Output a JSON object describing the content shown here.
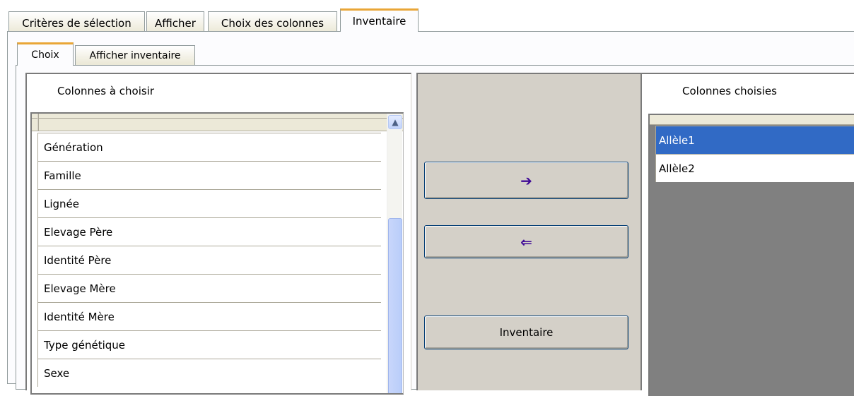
{
  "top_tabs": [
    {
      "label": "Critères de sélection"
    },
    {
      "label": "Afficher"
    },
    {
      "label": "Choix des colonnes"
    },
    {
      "label": "Inventaire"
    }
  ],
  "sub_tabs": [
    {
      "label": "Choix"
    },
    {
      "label": "Afficher inventaire"
    }
  ],
  "left_group": {
    "title": "Colonnes à choisir",
    "items": [
      "Génération",
      "Famille",
      "Lignée",
      "Elevage Père",
      "Identité Père",
      "Elevage Mère",
      "Identité Mère",
      "Type génétique",
      "Sexe"
    ]
  },
  "buttons": {
    "add_icon": "right-arrow-icon",
    "add_glyph": "➔",
    "remove_icon": "left-arrow-icon",
    "remove_glyph": "⇐",
    "inventory_label": "Inventaire"
  },
  "right_group": {
    "title": "Colonnes choisies",
    "items": [
      {
        "label": "Allèle1",
        "selected": true
      },
      {
        "label": "Allèle2",
        "selected": false
      }
    ]
  },
  "colors": {
    "active_tab_accent": "#e9a637",
    "selection": "#316ac5",
    "arrow": "#3f0a96"
  }
}
